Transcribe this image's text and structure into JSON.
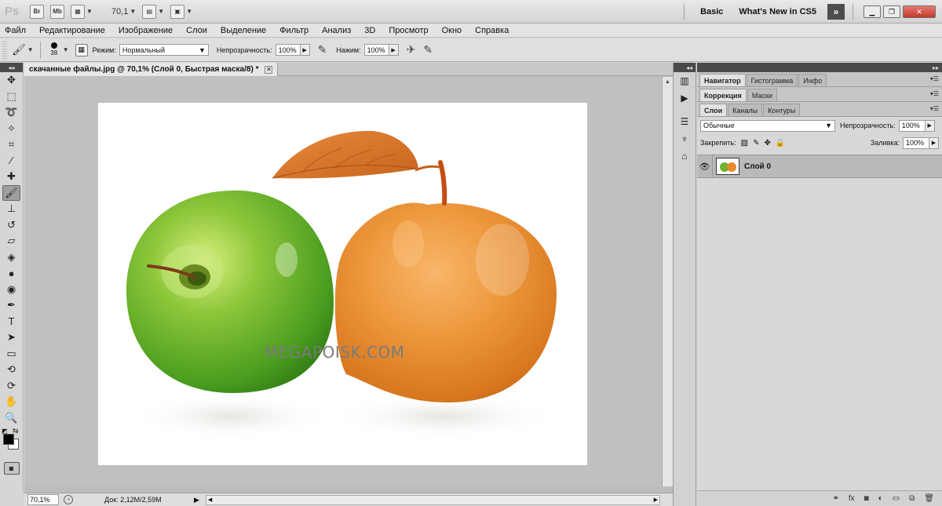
{
  "appbar": {
    "logo": "Ps",
    "bridge": "Br",
    "minibridge": "Mb",
    "zoom": "70,1",
    "workspace_basic": "Basic",
    "workspace_new": "What's New in CS5",
    "more": "»"
  },
  "menu": {
    "items": [
      "Файл",
      "Редактирование",
      "Изображение",
      "Слои",
      "Выделение",
      "Фильтр",
      "Анализ",
      "3D",
      "Просмотр",
      "Окно",
      "Справка"
    ]
  },
  "options": {
    "brush_size": "38",
    "mode_label": "Режим:",
    "mode_value": "Нормальный",
    "opacity_label": "Непрозрачность:",
    "opacity_value": "100%",
    "pressure_label": "Нажим:",
    "pressure_value": "100%"
  },
  "document": {
    "tab_title": "скачанные файлы.jpg @ 70,1% (Слой 0, Быстрая маска/8) *",
    "watermark": "MEGAPOISK.COM",
    "zoom_status": "70,1%",
    "doc_info": "Док: 2,12M/2,59M"
  },
  "panels": {
    "group1_tabs": [
      "Навигатор",
      "Гистограмма",
      "Инфо"
    ],
    "group2_tabs": [
      "Коррекция",
      "Маски"
    ],
    "group3_tabs": [
      "Слои",
      "Каналы",
      "Контуры"
    ],
    "blend_mode": "Обычные",
    "opacity_label": "Непрозрачность:",
    "opacity_value": "100%",
    "lock_label": "Закрепить:",
    "fill_label": "Заливка:",
    "fill_value": "100%",
    "layer_name": "Слой 0"
  },
  "colors": {
    "foreground": "#000000",
    "background": "#ffffff",
    "green_apple": "#6cb52c",
    "orange_apple": "#e8892c"
  }
}
